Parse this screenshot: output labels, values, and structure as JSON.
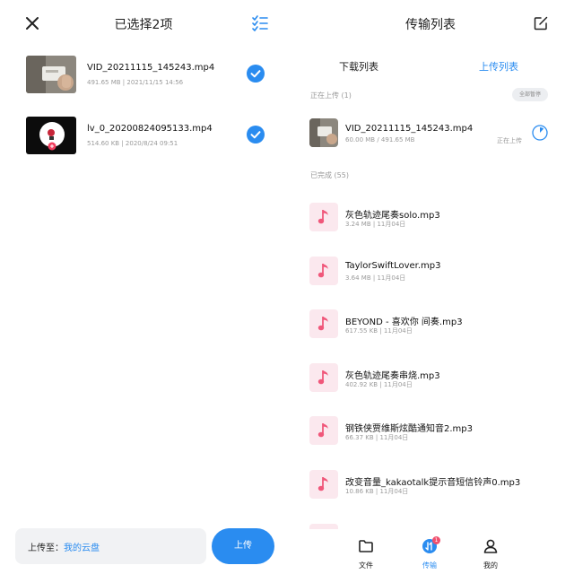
{
  "colors": {
    "accent": "#2a8cf0",
    "muted_text": "#9a9a9a",
    "music_tile_bg": "#fbe8ee",
    "music_note": "#f0577a",
    "badge": "#f0506e"
  },
  "left": {
    "close_icon": "close-icon",
    "title": "已选择2项",
    "select_all_icon": "checklist-icon",
    "files": [
      {
        "name": "VID_20211115_145243.mp4",
        "meta": "491.65 MB | 2021/11/15 14:56",
        "selected": true
      },
      {
        "name": "lv_0_20200824095133.mp4",
        "meta": "514.60 KB | 2020/8/24 09:51",
        "selected": true
      }
    ],
    "destination_label": "上传至：",
    "destination_value": "我的云盘",
    "upload_button": "上传"
  },
  "right": {
    "title": "传输列表",
    "tabs": [
      {
        "label": "下载列表",
        "active": false
      },
      {
        "label": "上传列表",
        "active": true
      }
    ],
    "uploading_section_label": "正在上传 (1)",
    "pause_all_button": "全部暂停",
    "uploading": {
      "name": "VID_20211115_145243.mp4",
      "meta": "60.00 MB / 491.65 MB",
      "status": "正在上传",
      "progress": 0.12
    },
    "completed_section_label": "已完成 (55)",
    "completed": [
      {
        "name": "灰色轨迹尾奏solo.mp3",
        "meta": "3.24 MB | 11月04日"
      },
      {
        "name": "TaylorSwiftLover.mp3",
        "meta": "3.64 MB | 11月04日"
      },
      {
        "name": "BEYOND - 喜欢你 间奏.mp3",
        "meta": "617.55 KB | 11月04日"
      },
      {
        "name": "灰色轨迹尾奏串烧.mp3",
        "meta": "402.92 KB | 11月04日"
      },
      {
        "name": "钢铁侠贾维斯炫酷通知音2.mp3",
        "meta": "66.37 KB | 11月04日"
      },
      {
        "name": "改变音量_kakaotalk提示音短信铃声0.mp3",
        "meta": "10.86 KB | 11月04日"
      }
    ],
    "bottom_nav": [
      {
        "label": "文件",
        "icon": "folder-icon",
        "active": false
      },
      {
        "label": "传输",
        "icon": "transfer-icon",
        "active": true,
        "badge": "1"
      },
      {
        "label": "我的",
        "icon": "person-icon",
        "active": false
      }
    ]
  }
}
